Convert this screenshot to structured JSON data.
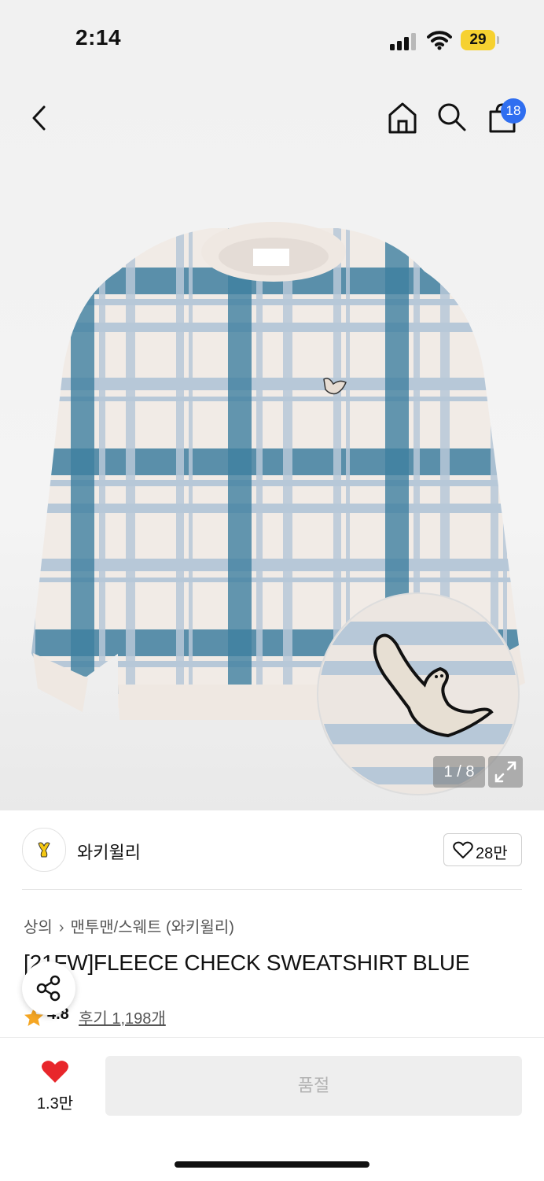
{
  "status_bar": {
    "time": "2:14",
    "battery": "29"
  },
  "nav": {
    "cart_count": "18"
  },
  "gallery": {
    "counter": "1 / 8"
  },
  "brand": {
    "name": "와키윌리",
    "likes": "28만"
  },
  "breadcrumb": {
    "items": [
      "상의",
      "맨투맨/스웨트 (와키윌리)"
    ]
  },
  "product": {
    "title": "[21FW]FLEECE CHECK SWEATSHIRT BLUE",
    "rating": "4.8",
    "reviews": "후기 1,198개"
  },
  "bottom": {
    "favorites": "1.3만",
    "buy_label": "품절"
  },
  "colors": {
    "accent_blue": "#2f6ef0",
    "heart_red": "#e8262b",
    "star_orange": "#f5a623",
    "battery_yellow": "#f6d130"
  }
}
